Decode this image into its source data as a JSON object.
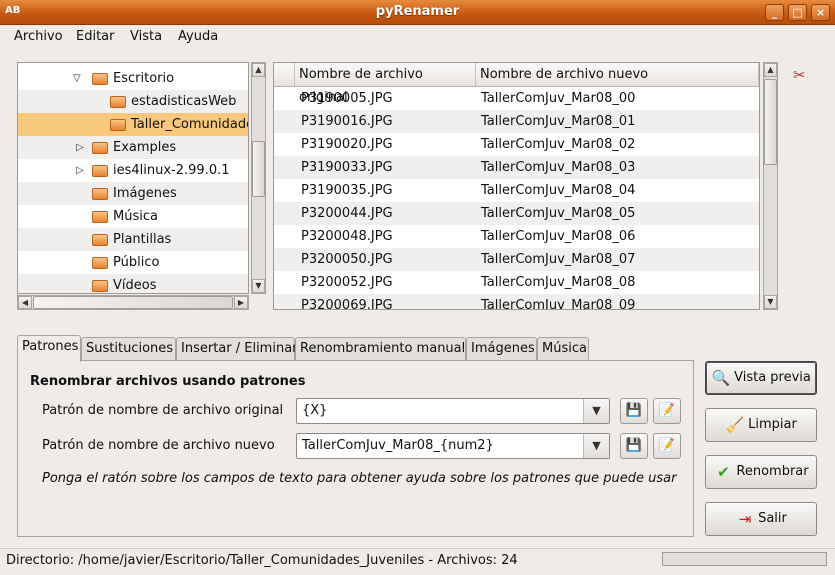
{
  "window": {
    "title": "pyRenamer",
    "app_icon": "AB"
  },
  "menu": [
    "Archivo",
    "Editar",
    "Vista",
    "Ayuda"
  ],
  "tree": {
    "items": [
      {
        "label": "Escritorio",
        "expander": "open"
      },
      {
        "label": "estadisticasWeb",
        "expander": "none"
      },
      {
        "label": "Taller_Comunidades_Juveniles",
        "expander": "none"
      },
      {
        "label": "Examples",
        "expander": "closed"
      },
      {
        "label": "ies4linux-2.99.0.1",
        "expander": "closed"
      },
      {
        "label": "Imágenes",
        "expander": "none"
      },
      {
        "label": "Música",
        "expander": "none"
      },
      {
        "label": "Plantillas",
        "expander": "none"
      },
      {
        "label": "Público",
        "expander": "none"
      },
      {
        "label": "Vídeos",
        "expander": "none"
      }
    ]
  },
  "files": {
    "columns": [
      "Nombre de archivo original",
      "Nombre de archivo nuevo"
    ],
    "rows": [
      [
        "P3190005.JPG",
        "TallerComJuv_Mar08_00"
      ],
      [
        "P3190016.JPG",
        "TallerComJuv_Mar08_01"
      ],
      [
        "P3190020.JPG",
        "TallerComJuv_Mar08_02"
      ],
      [
        "P3190033.JPG",
        "TallerComJuv_Mar08_03"
      ],
      [
        "P3190035.JPG",
        "TallerComJuv_Mar08_04"
      ],
      [
        "P3200044.JPG",
        "TallerComJuv_Mar08_05"
      ],
      [
        "P3200048.JPG",
        "TallerComJuv_Mar08_06"
      ],
      [
        "P3200050.JPG",
        "TallerComJuv_Mar08_07"
      ],
      [
        "P3200052.JPG",
        "TallerComJuv_Mar08_08"
      ],
      [
        "P3200069.JPG",
        "TallerComJuv_Mar08_09"
      ]
    ]
  },
  "tabs": [
    "Patrones",
    "Sustituciones",
    "Insertar / Eliminar",
    "Renombramiento manual",
    "Imágenes",
    "Música"
  ],
  "patterns": {
    "heading": "Renombrar archivos usando patrones",
    "original_label": "Patrón de nombre de archivo original",
    "original_value": "{X}",
    "new_label": "Patrón de nombre de archivo nuevo",
    "new_value": "TallerComJuv_Mar08_{num2}",
    "hint": "Ponga el ratón sobre los campos de texto para obtener ayuda sobre los patrones que puede usar"
  },
  "buttons": {
    "preview": "Vista previa",
    "clear": "Limpiar",
    "rename": "Renombrar",
    "exit": "Salir"
  },
  "status": {
    "text": "Directorio: /home/javier/Escritorio/Taller_Comunidades_Juveniles - Archivos: 24"
  },
  "colors": {
    "titlebar": "#d26b22",
    "selection": "#f8c87c"
  }
}
